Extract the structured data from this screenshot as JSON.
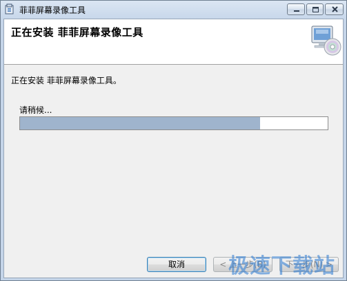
{
  "window": {
    "title": "菲菲屏幕录像工具"
  },
  "banner": {
    "title": "正在安装 菲菲屏幕录像工具"
  },
  "status": {
    "text": "正在安装 菲菲屏幕录像工具。"
  },
  "progress": {
    "label": "请稍候...",
    "fraction": 0.78,
    "fill_color": "#9fb4cd"
  },
  "buttons": {
    "cancel_label": "取消",
    "back_label": "< 上一步(B)",
    "next_label": "下一步(N) >"
  },
  "watermark": {
    "text": "极速下载站"
  },
  "icons": {
    "app": "installer-package-icon",
    "banner": "computer-cd-icon",
    "minimize": "minimize-icon",
    "maximize": "maximize-icon",
    "close": "close-icon"
  }
}
